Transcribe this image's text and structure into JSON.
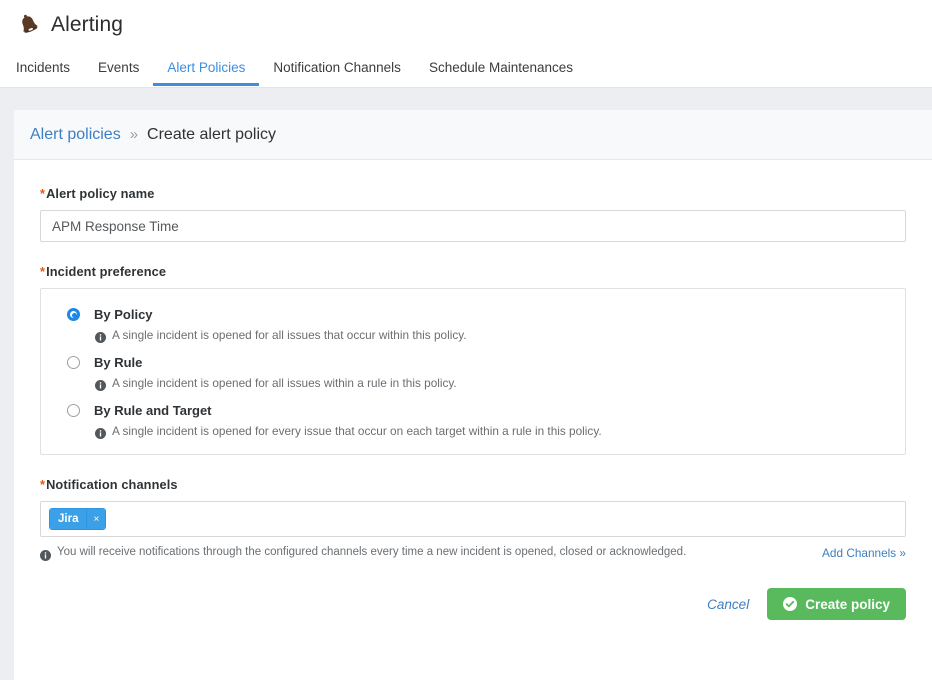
{
  "app": {
    "title": "Alerting",
    "icon": "bell-icon"
  },
  "nav": {
    "tabs": [
      {
        "label": "Incidents",
        "active": false
      },
      {
        "label": "Events",
        "active": false
      },
      {
        "label": "Alert Policies",
        "active": true
      },
      {
        "label": "Notification Channels",
        "active": false
      },
      {
        "label": "Schedule Maintenances",
        "active": false
      }
    ]
  },
  "breadcrumb": {
    "parent": "Alert policies",
    "separator": "»",
    "current": "Create alert policy"
  },
  "form": {
    "policy_name": {
      "required_marker": "*",
      "label": "Alert policy name",
      "value": "APM Response Time",
      "placeholder": ""
    },
    "incident_preference": {
      "required_marker": "*",
      "label": "Incident preference",
      "options": [
        {
          "label": "By Policy",
          "description": "A single incident is opened for all issues that occur within this policy.",
          "selected": true
        },
        {
          "label": "By Rule",
          "description": "A single incident is opened for all issues within a rule in this policy.",
          "selected": false
        },
        {
          "label": "By Rule and Target",
          "description": "A single incident is opened for every issue that occur on each target within a rule in this policy.",
          "selected": false
        }
      ]
    },
    "notification_channels": {
      "required_marker": "*",
      "label": "Notification channels",
      "tags": [
        {
          "label": "Jira",
          "remove_glyph": "×"
        }
      ],
      "helper_text": "You will receive notifications through the configured channels every time a new incident is opened, closed or acknowledged.",
      "add_link": "Add Channels »"
    }
  },
  "footer": {
    "cancel_label": "Cancel",
    "submit_label": "Create policy"
  },
  "colors": {
    "accent_blue": "#3e8ede",
    "link_blue": "#3e7fc1",
    "required_orange": "#e8590c",
    "tag_blue": "#3aa0e8",
    "submit_green": "#58ba5c",
    "page_bg": "#edeef2"
  }
}
